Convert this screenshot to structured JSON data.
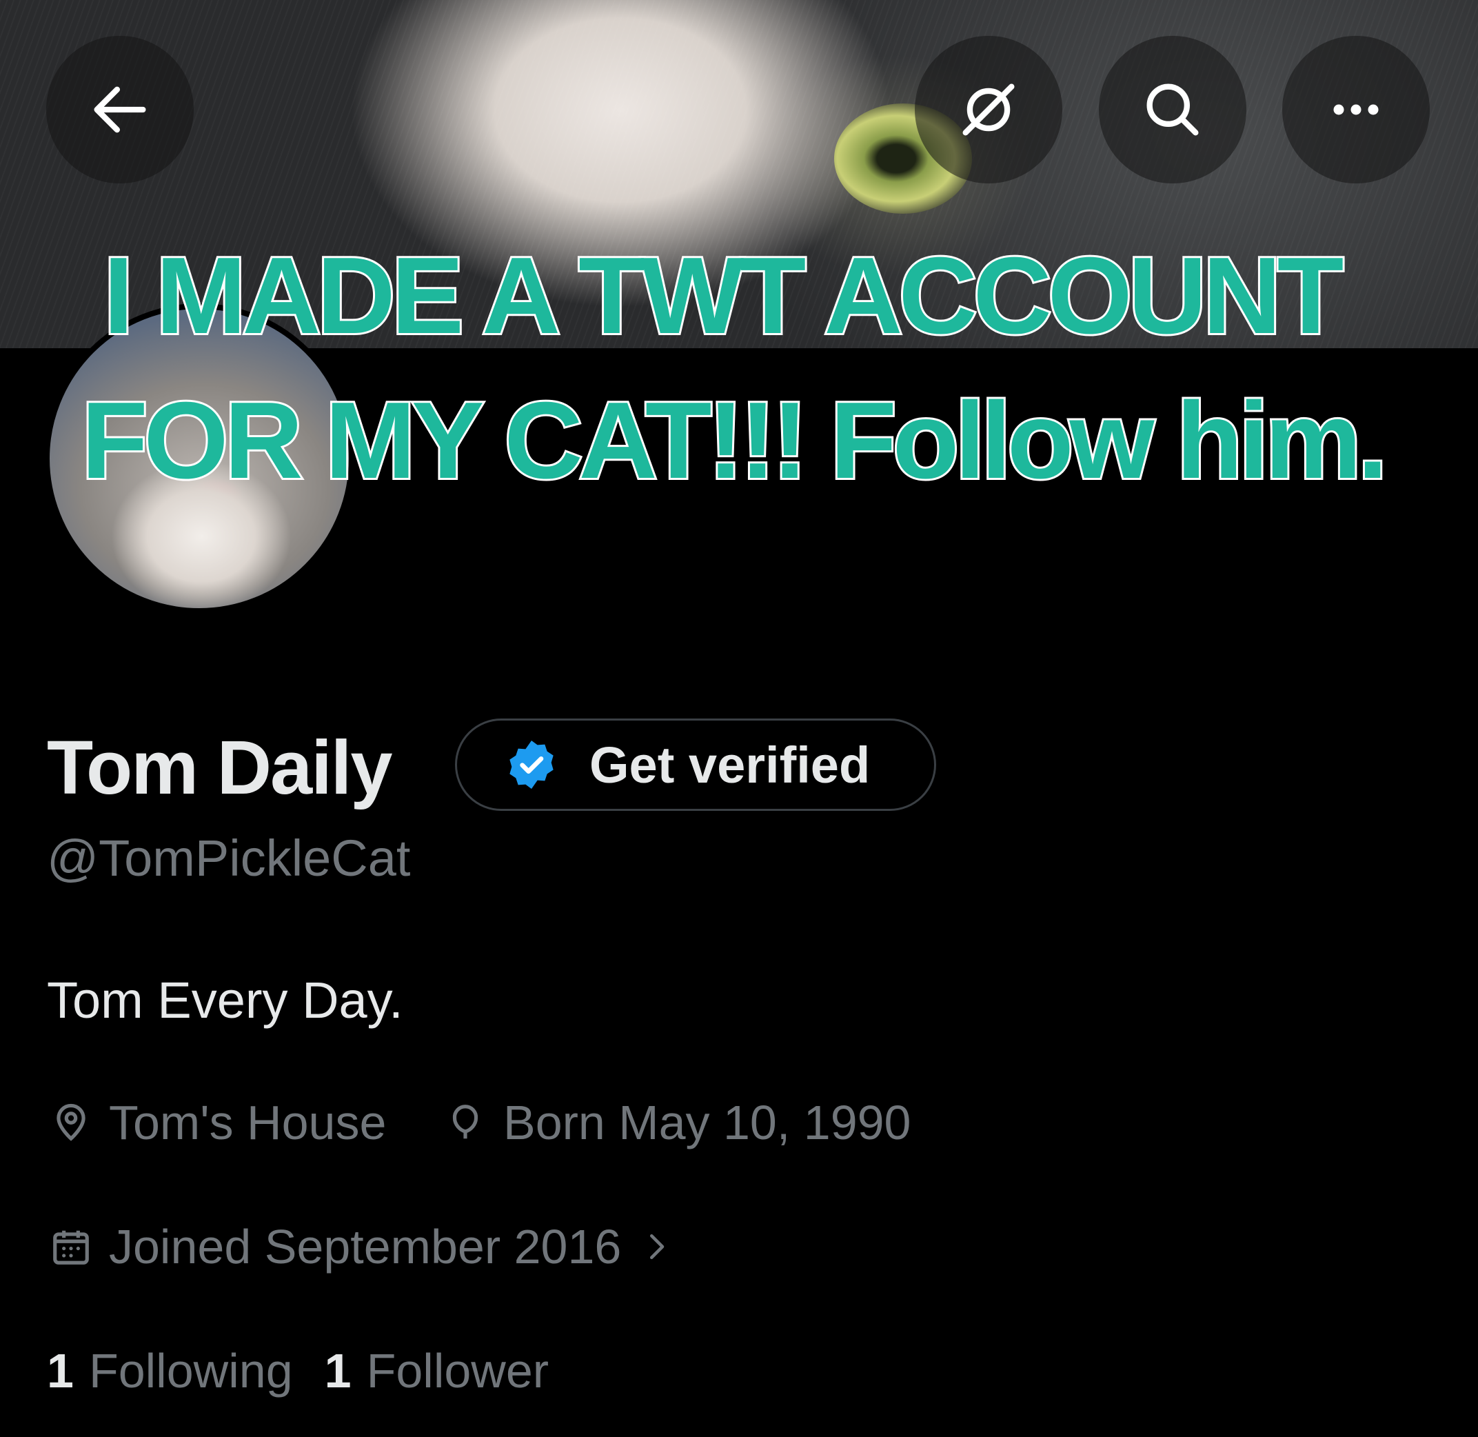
{
  "caption": {
    "line1": "I MADE A TWT ACCOUNT",
    "line2": "FOR MY CAT!!! Follow him."
  },
  "header": {
    "back_icon": "arrow-left-icon",
    "grok_icon": "grok-icon",
    "search_icon": "search-icon",
    "more_icon": "more-horizontal-icon"
  },
  "profile": {
    "display_name": "Tom Daily",
    "verify_label": "Get verified",
    "handle": "@TomPickleCat",
    "bio": "Tom Every Day.",
    "location": "Tom's House",
    "birthday": "Born May 10, 1990",
    "joined": "Joined September 2016",
    "following_count": "1",
    "following_label": "Following",
    "followers_count": "1",
    "followers_label": "Follower"
  },
  "colors": {
    "background": "#000000",
    "primary_text": "#e7e9ea",
    "secondary_text": "#71767b",
    "verified_blue": "#1d9bf0",
    "caption_teal": "#1eb89c"
  }
}
